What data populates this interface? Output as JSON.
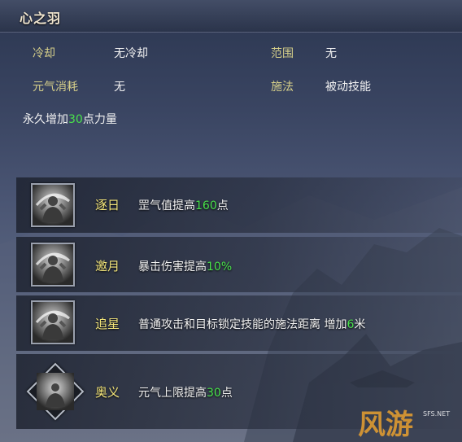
{
  "skill": {
    "title": "心之羽"
  },
  "stats": {
    "cooldown_label": "冷却",
    "cooldown_value": "无冷却",
    "range_label": "范围",
    "range_value": "无",
    "cost_label": "元气消耗",
    "cost_value": "无",
    "cast_label": "施法",
    "cast_value": "被动技能"
  },
  "description": {
    "prefix": "永久增加",
    "number": "30",
    "suffix": "点力量"
  },
  "tiers": [
    {
      "name": "逐日",
      "prefix": "罡气值提高",
      "number": "160",
      "suffix": "点"
    },
    {
      "name": "邀月",
      "prefix": "暴击伤害提高",
      "number": "10%",
      "suffix": ""
    },
    {
      "name": "追星",
      "prefix": "普通攻击和目标锁定技能的施法距离 增加",
      "number": "6",
      "suffix": "米"
    },
    {
      "name": "奥义",
      "prefix": "元气上限提高",
      "number": "30",
      "suffix": "点"
    }
  ],
  "watermark": {
    "text": "风游",
    "site": "SFS.NET"
  },
  "colors": {
    "highlight": "#49e24b",
    "tier_name": "#f3e57a",
    "title": "#f1e6cf"
  },
  "icons": [
    "warrior-vortex-icon",
    "warrior-vortex-icon",
    "warrior-vortex-icon",
    "warrior-vortex-diamond-icon"
  ]
}
